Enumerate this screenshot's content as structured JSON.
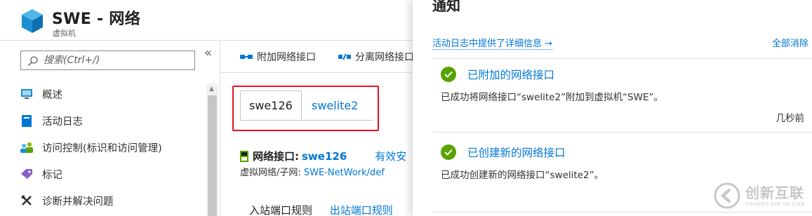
{
  "resource": {
    "title": "SWE - 网络",
    "subtitle": "虚拟机"
  },
  "sidebar": {
    "search_placeholder": "搜索(Ctrl+/)",
    "collapse_glyph": "«",
    "items": [
      {
        "label": "概述",
        "icon": "monitor-icon"
      },
      {
        "label": "活动日志",
        "icon": "log-icon"
      },
      {
        "label": "访问控制(标识和访问管理)",
        "icon": "people-icon"
      },
      {
        "label": "标记",
        "icon": "tag-icon"
      },
      {
        "label": "诊断并解决问题",
        "icon": "wrench-icon"
      }
    ]
  },
  "toolbar": {
    "attach_label": "附加网络接口",
    "detach_label": "分离网络接口"
  },
  "content": {
    "tabs": [
      {
        "label": "swe126",
        "active": true
      },
      {
        "label": "swelite2",
        "active": false
      }
    ],
    "nic_label": "网络接口:",
    "nic_value": "swe126",
    "effective_label": "有效安",
    "subnet_label": "虚拟网络/子网:",
    "subnet_value": "SWE-NetWork/def",
    "inbound_label": "入站端口规则",
    "outbound_label": "出站端口规则"
  },
  "notifications_panel": {
    "title": "通知",
    "activity_log_link": "活动日志中提供了详细信息",
    "activity_log_arrow": "→",
    "dismiss_all": "全部消除",
    "items": [
      {
        "title": "已附加的网络接口",
        "description": "已成功将网络接口“swelite2”附加到虚拟机“SWE”。",
        "time": "几秒前",
        "status": "success"
      },
      {
        "title": "已创建新的网络接口",
        "description": "已成功创建新的网络接口“swelite2”。",
        "time": "",
        "status": "success"
      }
    ]
  },
  "watermark": {
    "text": "创新互联",
    "subtext": "CHUANG XIN HU LIAN"
  },
  "colors": {
    "accent": "#0078d4",
    "success": "#57a300",
    "highlight_box": "#e81123"
  }
}
